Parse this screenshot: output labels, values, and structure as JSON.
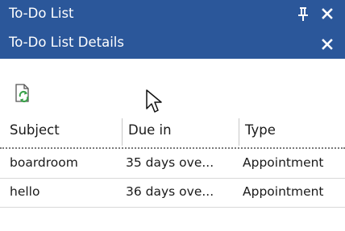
{
  "panel": {
    "title": "To-Do List",
    "details_title": "To-Do List Details"
  },
  "columns": [
    "Subject",
    "Due in",
    "Type"
  ],
  "rows": [
    {
      "subject": "boardroom",
      "due_in": "35 days ove...",
      "type": "Appointment"
    },
    {
      "subject": "hello",
      "due_in": "36 days ove...",
      "type": "Appointment"
    }
  ],
  "icons": {
    "pin": "pin-icon",
    "close": "close-icon",
    "refresh": "refresh-icon",
    "cursor": "mouse-cursor-icon"
  },
  "colors": {
    "titlebar": "#2b579a",
    "refresh_arrow": "#3aa14a"
  }
}
